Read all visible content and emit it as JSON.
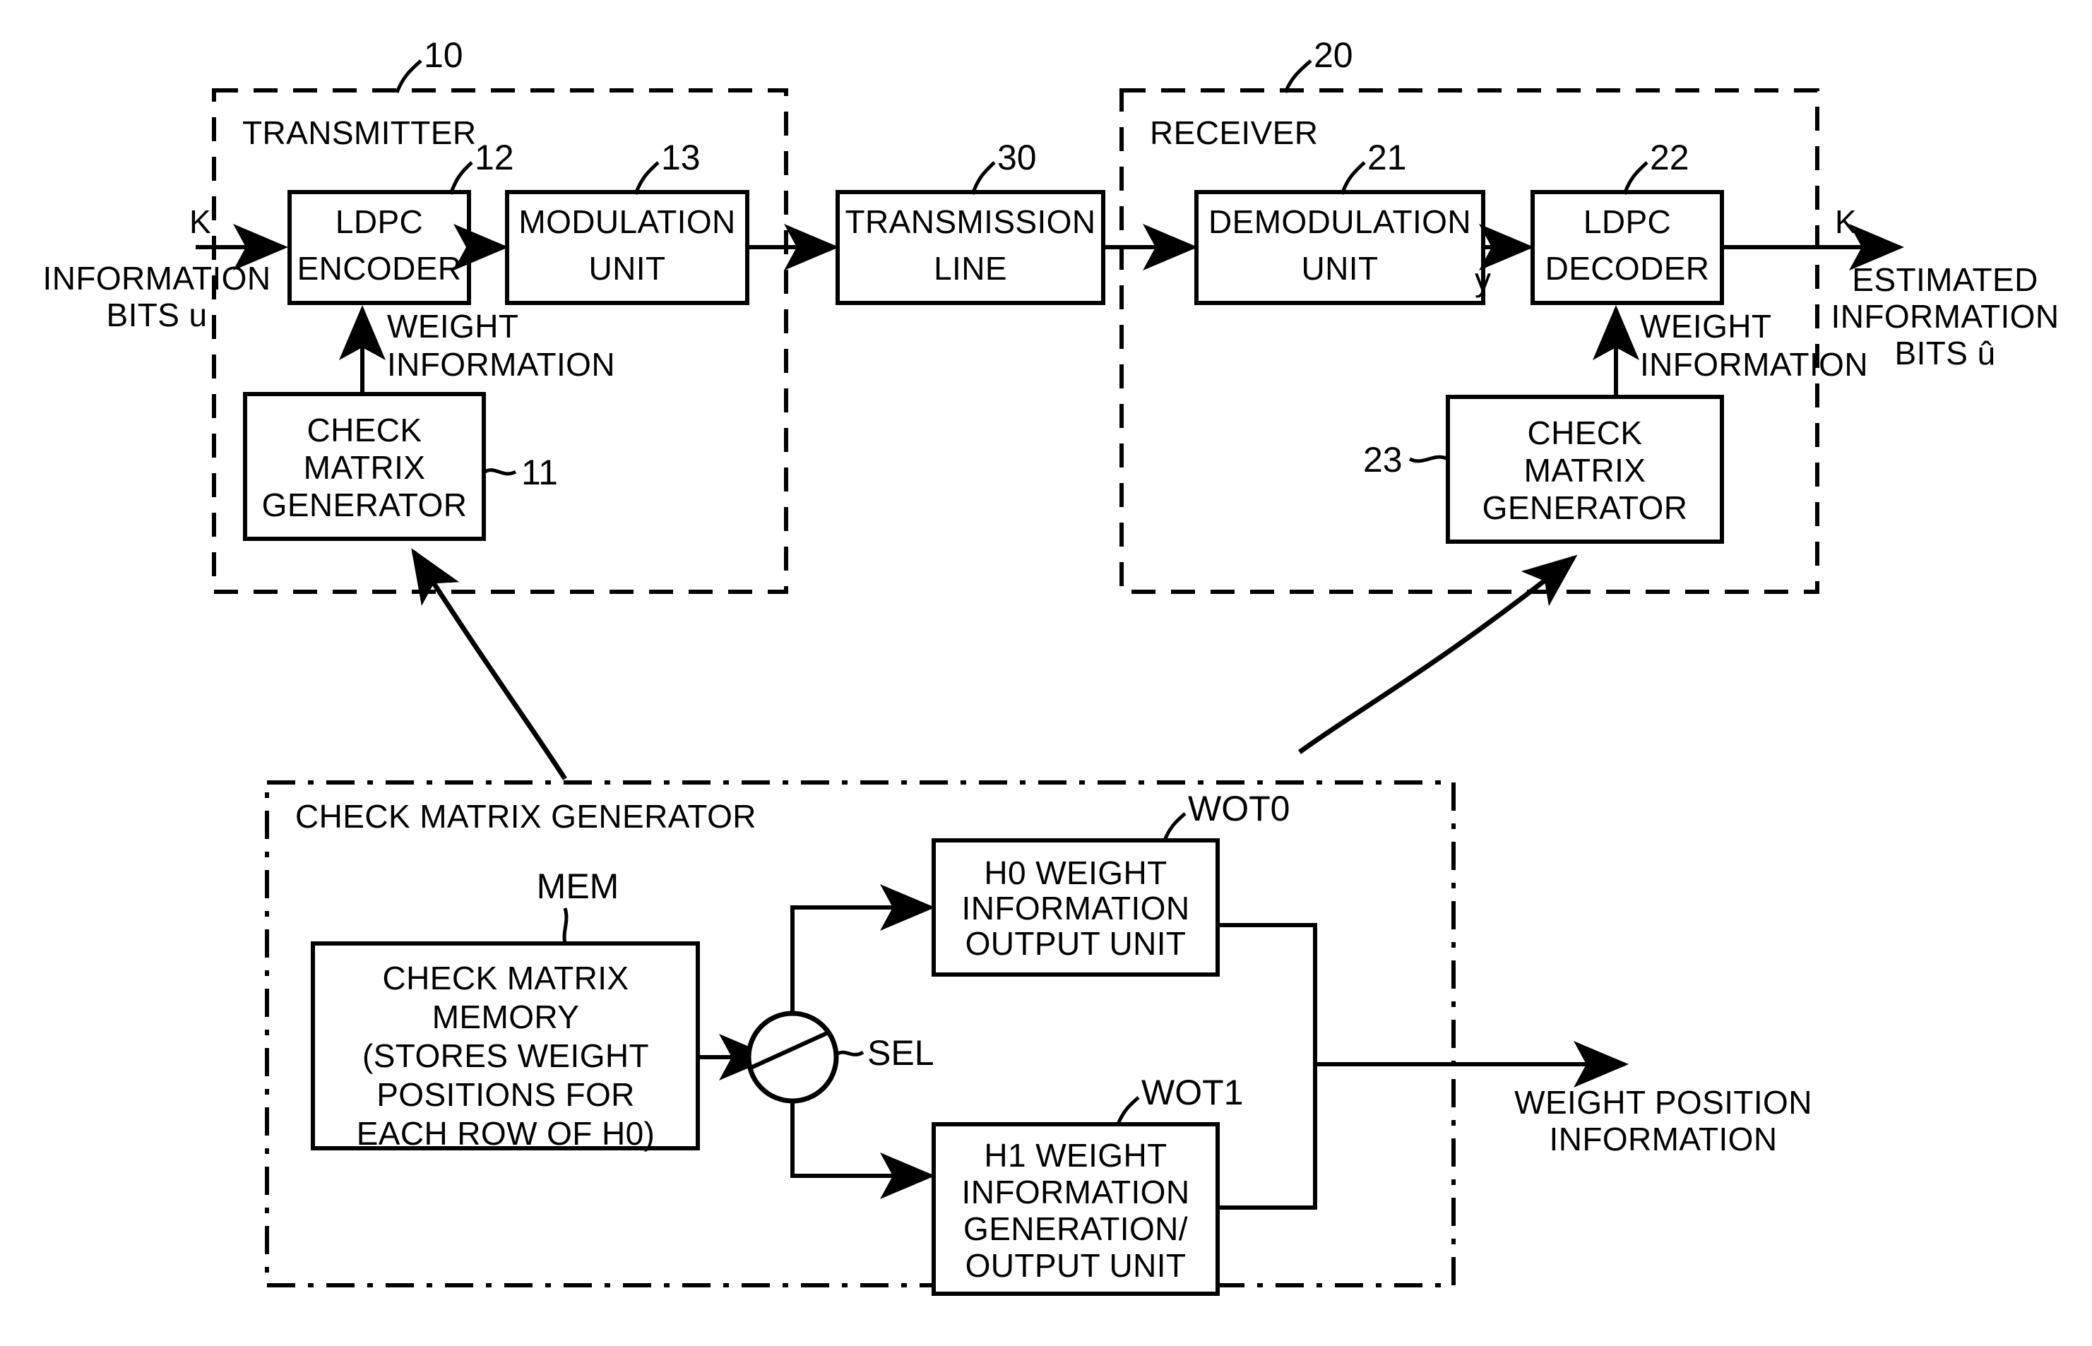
{
  "figure": {
    "title": "LDPC transmitter-receiver block diagram with check matrix generator"
  },
  "transmitter": {
    "label": "TRANSMITTER",
    "ref": "10",
    "blocks": [
      {
        "ref": "12",
        "line1": "LDPC",
        "line2": "ENCODER"
      },
      {
        "ref": "13",
        "line1": "MODULATION",
        "line2": "UNIT"
      },
      {
        "ref": "11",
        "line1": "CHECK",
        "line2": "MATRIX",
        "line3": "GENERATOR"
      }
    ],
    "weight_info_label_line1": "WEIGHT",
    "weight_info_label_line2": "INFORMATION"
  },
  "channel": {
    "ref": "30",
    "line1": "TRANSMISSION",
    "line2": "LINE"
  },
  "receiver": {
    "label": "RECEIVER",
    "ref": "20",
    "blocks": [
      {
        "ref": "21",
        "line1": "DEMODULATION",
        "line2": "UNIT"
      },
      {
        "ref": "22",
        "line1": "LDPC",
        "line2": "DECODER"
      },
      {
        "ref": "23",
        "line1": "CHECK",
        "line2": "MATRIX",
        "line3": "GENERATOR"
      }
    ],
    "weight_info_label_line1": "WEIGHT",
    "weight_info_label_line2": "INFORMATION",
    "demod_output_signal": "y"
  },
  "io": {
    "input_k": "K",
    "input_line1": "INFORMATION",
    "input_line2": "BITS u",
    "output_k": "K",
    "output_line1": "ESTIMATED",
    "output_line2": "INFORMATION",
    "output_line3": "BITS û"
  },
  "detail": {
    "label": "CHECK MATRIX GENERATOR",
    "memory": {
      "ref": "MEM",
      "line1": "CHECK MATRIX",
      "line2": "MEMORY",
      "line3": "(STORES WEIGHT",
      "line4": "POSITIONS FOR",
      "line5": "EACH ROW OF H0)"
    },
    "selector": {
      "ref": "SEL",
      "icon": "switch-circle-icon"
    },
    "h0_unit": {
      "ref": "WOT0",
      "line1": "H0 WEIGHT",
      "line2": "INFORMATION",
      "line3": "OUTPUT UNIT"
    },
    "h1_unit": {
      "ref": "WOT1",
      "line1": "H1 WEIGHT",
      "line2": "INFORMATION",
      "line3": "GENERATION/",
      "line4": "OUTPUT UNIT"
    },
    "output_line1": "WEIGHT POSITION",
    "output_line2": "INFORMATION"
  },
  "colors": {
    "ink": "#000000",
    "paper": "#ffffff"
  }
}
